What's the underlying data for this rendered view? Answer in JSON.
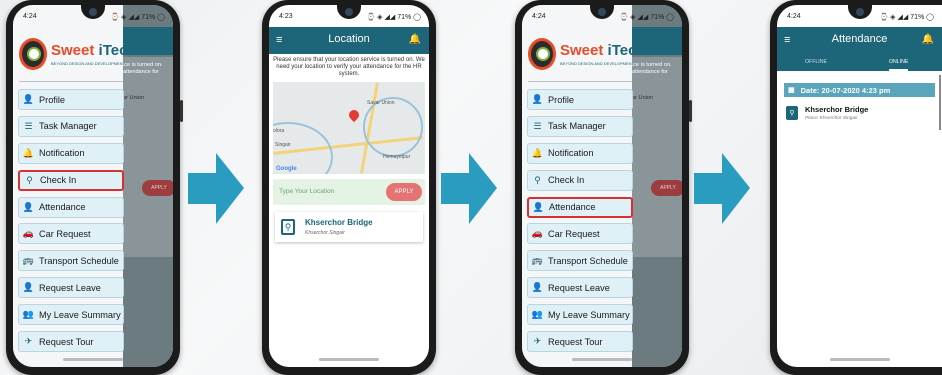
{
  "phones": [
    {
      "time": "4:24",
      "status": "⌚ ◈ ◢◢ 71% ◯",
      "logo": {
        "brand1": "Sweet ",
        "brand2": "iTech",
        "tagline": "BEYOND DESIGN AND DEVELOPMENT"
      },
      "peek_top": "ice is turned on.",
      "peek_top2": "attendance for",
      "peek_map": "ar Union",
      "apply": "APPLY",
      "menu": [
        "Profile",
        "Task Manager",
        "Notification",
        "Check In",
        "Attendance",
        "Car Request",
        "Transport Schedule",
        "Request Leave",
        "My Leave Summary",
        "Request Tour"
      ]
    },
    {
      "time": "4:23",
      "status": "⌚ ◈ ◢◢ 71% ◯",
      "header": "Location",
      "note": "Please ensure that your location service is turned on. We need your location to verify your attendance for the HR system.",
      "map_labels": {
        "savar": "Savar Union",
        "jolora": "olora",
        "singair": "Singair",
        "hemayetpur": "Hemayetpur",
        "google": "Google"
      },
      "placeholder": "Type Your Location",
      "apply": "APPLY",
      "place_name": "Khserchor Bridge",
      "place_sub": "Khserchor Singair"
    },
    {
      "time": "4:24",
      "status": "⌚ ◈ ◢◢ 71% ◯",
      "logo": {
        "brand1": "Sweet ",
        "brand2": "iTech",
        "tagline": "BEYOND DESIGN AND DEVELOPMENT"
      },
      "peek_top": "ice is turned on.",
      "peek_top2": "attendance for",
      "peek_map": "ar Union",
      "apply": "APPLY",
      "menu": [
        "Profile",
        "Task Manager",
        "Notification",
        "Check In",
        "Attendance",
        "Car Request",
        "Transport Schedule",
        "Request Leave",
        "My Leave Summary",
        "Request Tour"
      ]
    },
    {
      "time": "4:24",
      "status": "⌚ ◈ ◢◢ 71% ◯",
      "header": "Attendance",
      "tab_offline": "OFFLINE",
      "tab_online": "ONLINE",
      "date": "Date: 20-07-2020 4:23 pm",
      "place_name": "Khserchor Bridge",
      "place_sub": "Place: Khserchor Singair"
    }
  ],
  "colors": {
    "primary": "#1d6578",
    "accent": "#2a9cc0",
    "highlight": "#d63031",
    "apply": "#e57373"
  },
  "icons": [
    "profile-icon",
    "task-icon",
    "bell-icon",
    "location-icon",
    "attendance-icon",
    "car-icon",
    "bus-icon",
    "leave-icon",
    "summary-icon",
    "plane-icon"
  ]
}
